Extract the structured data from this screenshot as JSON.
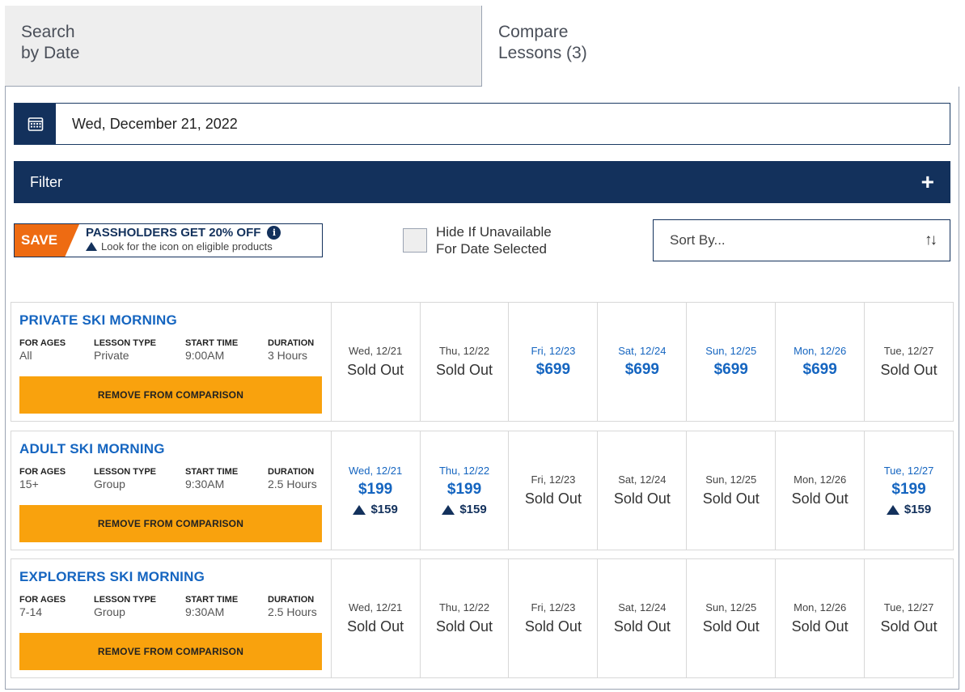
{
  "tabs": {
    "search_line1": "Search",
    "search_line2": "by Date",
    "compare_line1": "Compare",
    "compare_line2": "Lessons (3)"
  },
  "date_picker": {
    "value": "Wed, December 21, 2022",
    "icon": "calendar-icon"
  },
  "filter": {
    "label": "Filter",
    "icon": "plus-icon"
  },
  "promo": {
    "tag": "SAVE",
    "title": "PASSHOLDERS GET 20% OFF",
    "subtitle": "Look for the icon on eligible products",
    "accent": "#ee6b12"
  },
  "hide_unavailable": {
    "line1": "Hide If Unavailable",
    "line2": "For Date Selected",
    "checked": false
  },
  "sort": {
    "label": "Sort By...",
    "icon": "sort-arrows-icon"
  },
  "meta_keys": {
    "ages": "FOR AGES",
    "type": "LESSON TYPE",
    "start": "START TIME",
    "duration": "DURATION"
  },
  "remove_label": "REMOVE FROM COMPARISON",
  "lessons": [
    {
      "title": "PRIVATE SKI MORNING",
      "ages": "All",
      "type": "Private",
      "start": "9:00AM",
      "duration": "3 Hours",
      "days": [
        {
          "label": "Wed, 12/21",
          "status": "Sold Out"
        },
        {
          "label": "Thu, 12/22",
          "status": "Sold Out"
        },
        {
          "label": "Fri, 12/23",
          "price": "$699"
        },
        {
          "label": "Sat, 12/24",
          "price": "$699"
        },
        {
          "label": "Sun, 12/25",
          "price": "$699"
        },
        {
          "label": "Mon, 12/26",
          "price": "$699"
        },
        {
          "label": "Tue, 12/27",
          "status": "Sold Out"
        }
      ]
    },
    {
      "title": "ADULT SKI MORNING",
      "ages": "15+",
      "type": "Group",
      "start": "9:30AM",
      "duration": "2.5 Hours",
      "days": [
        {
          "label": "Wed, 12/21",
          "price": "$199",
          "pass_price": "$159"
        },
        {
          "label": "Thu, 12/22",
          "price": "$199",
          "pass_price": "$159"
        },
        {
          "label": "Fri, 12/23",
          "status": "Sold Out"
        },
        {
          "label": "Sat, 12/24",
          "status": "Sold Out"
        },
        {
          "label": "Sun, 12/25",
          "status": "Sold Out"
        },
        {
          "label": "Mon, 12/26",
          "status": "Sold Out"
        },
        {
          "label": "Tue, 12/27",
          "price": "$199",
          "pass_price": "$159"
        }
      ]
    },
    {
      "title": "EXPLORERS SKI MORNING",
      "ages": "7-14",
      "type": "Group",
      "start": "9:30AM",
      "duration": "2.5 Hours",
      "days": [
        {
          "label": "Wed, 12/21",
          "status": "Sold Out"
        },
        {
          "label": "Thu, 12/22",
          "status": "Sold Out"
        },
        {
          "label": "Fri, 12/23",
          "status": "Sold Out"
        },
        {
          "label": "Sat, 12/24",
          "status": "Sold Out"
        },
        {
          "label": "Sun, 12/25",
          "status": "Sold Out"
        },
        {
          "label": "Mon, 12/26",
          "status": "Sold Out"
        },
        {
          "label": "Tue, 12/27",
          "status": "Sold Out"
        }
      ]
    }
  ],
  "colors": {
    "navy": "#13315c",
    "link_blue": "#1565c0",
    "button_orange": "#f9a20d"
  }
}
